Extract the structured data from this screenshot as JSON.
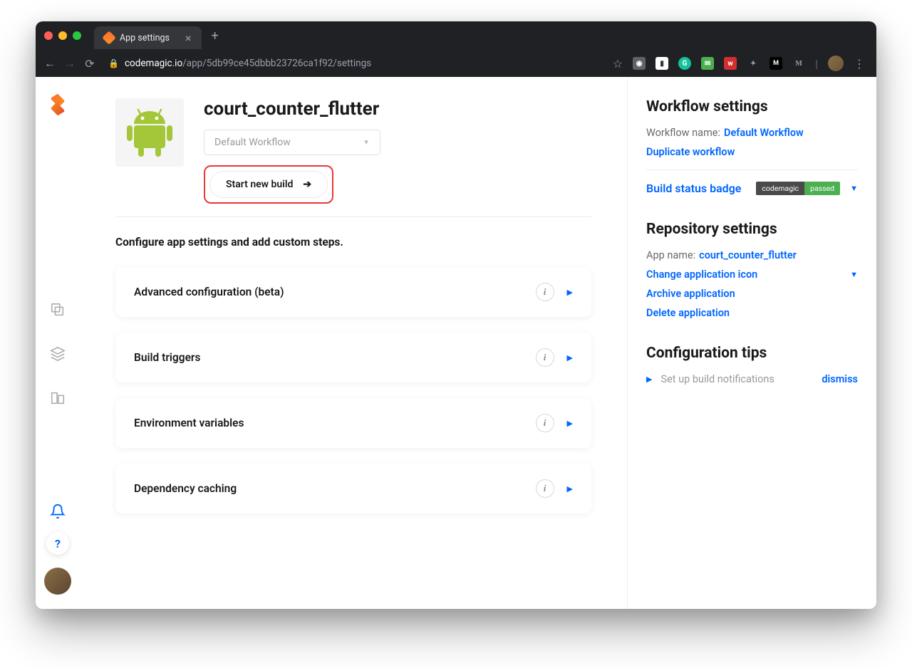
{
  "browser": {
    "tab_title": "App settings",
    "url_host": "codemagic.io",
    "url_path": "/app/5db99ce45dbbb23726ca1f92/settings"
  },
  "app": {
    "title": "court_counter_flutter",
    "workflow_selected": "Default Workflow",
    "start_build_label": "Start new build"
  },
  "section_title": "Configure app settings and add custom steps.",
  "cards": [
    {
      "title": "Advanced configuration (beta)"
    },
    {
      "title": "Build triggers"
    },
    {
      "title": "Environment variables"
    },
    {
      "title": "Dependency caching"
    }
  ],
  "workflow_settings": {
    "heading": "Workflow settings",
    "name_label": "Workflow name:",
    "name_value": "Default Workflow",
    "duplicate": "Duplicate workflow",
    "badge_label": "Build status badge",
    "badge_left": "codemagic",
    "badge_right": "passed"
  },
  "repo_settings": {
    "heading": "Repository settings",
    "name_label": "App name:",
    "name_value": "court_counter_flutter",
    "change_icon": "Change application icon",
    "archive": "Archive application",
    "delete": "Delete application"
  },
  "tips": {
    "heading": "Configuration tips",
    "item": "Set up build notifications",
    "dismiss": "dismiss"
  }
}
